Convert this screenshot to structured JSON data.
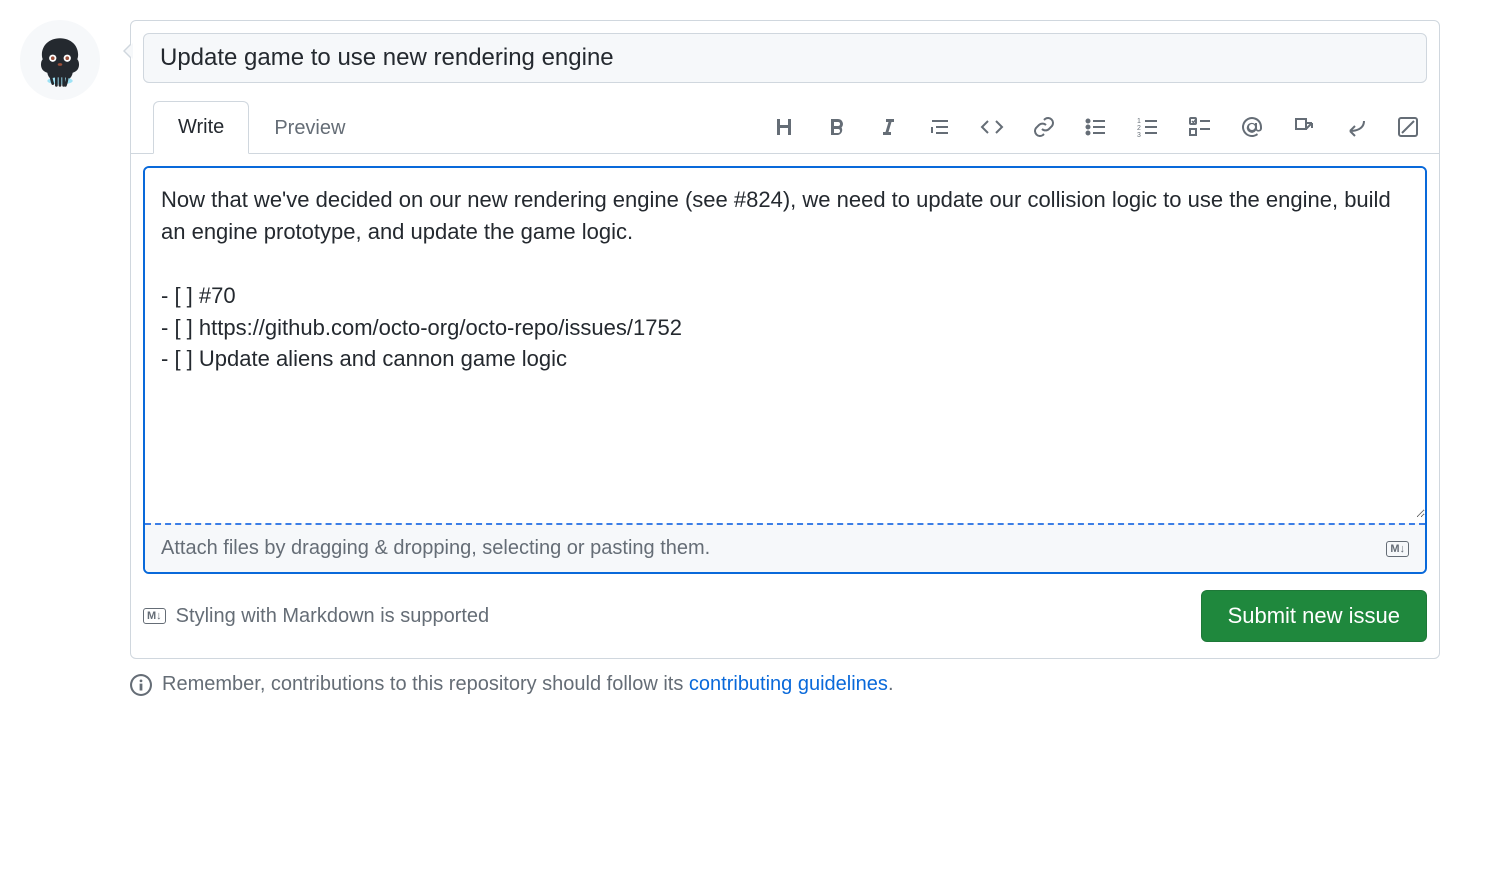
{
  "issue": {
    "title": "Update game to use new rendering engine",
    "body": "Now that we've decided on our new rendering engine (see #824), we need to update our collision logic to use the engine, build an engine prototype, and update the game logic.\n\n- [ ] #70\n- [ ] https://github.com/octo-org/octo-repo/issues/1752\n- [ ] Update aliens and cannon game logic"
  },
  "tabs": {
    "write": "Write",
    "preview": "Preview"
  },
  "toolbar_icons": [
    "heading",
    "bold",
    "italic",
    "quote",
    "code",
    "link",
    "unordered-list",
    "ordered-list",
    "task-list",
    "mention",
    "cross-reference",
    "reply",
    "saved-replies"
  ],
  "attach": {
    "text": "Attach files by dragging & dropping, selecting or pasting them.",
    "badge": "M↓"
  },
  "footer": {
    "markdown_badge": "M↓",
    "markdown_text": "Styling with Markdown is supported",
    "submit_label": "Submit new issue"
  },
  "hint": {
    "prefix": "Remember, contributions to this repository should follow its ",
    "link_text": "contributing guidelines",
    "suffix": "."
  }
}
